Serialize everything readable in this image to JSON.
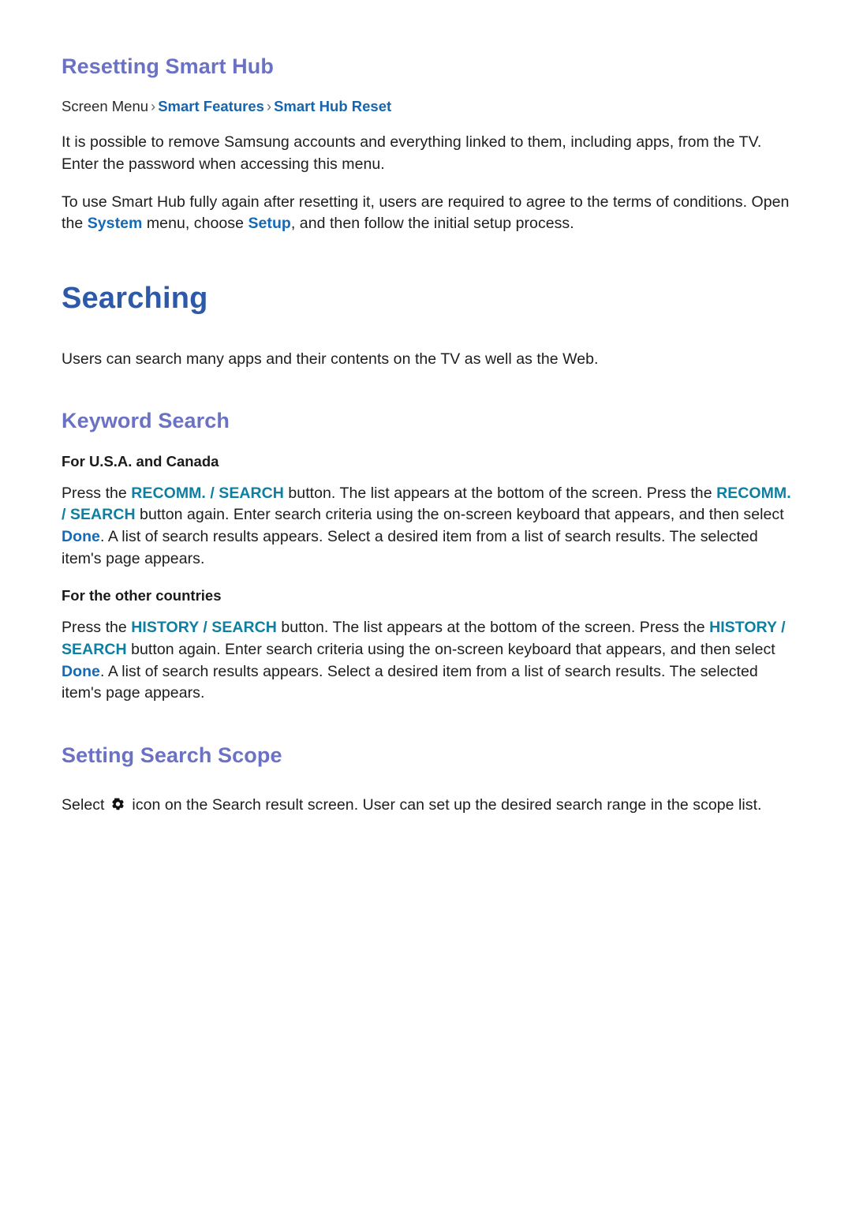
{
  "colors": {
    "section_heading": "#6b72c4",
    "chapter_heading": "#2d5aa8",
    "link_blue": "#1565b0",
    "keyword_blue": "#1569b5",
    "keyword_teal": "#0e7fa0",
    "body_text": "#1d1d1d",
    "page_background": "#ffffff"
  },
  "sections": {
    "resetting": {
      "heading": "Resetting Smart Hub",
      "breadcrumb": {
        "root": "Screen Menu",
        "sep1": "›",
        "item1": "Smart Features",
        "sep2": "›",
        "item2": "Smart Hub Reset"
      },
      "paragraph1": "It is possible to remove Samsung accounts and everything linked to them, including apps, from the TV. Enter the password when accessing this menu.",
      "paragraph2": {
        "part1": "To use Smart Hub fully again after resetting it, users are required to agree to the terms of conditions. Open the ",
        "kw1": "System",
        "part2": " menu, choose ",
        "kw2": "Setup",
        "part3": ", and then follow the initial setup process."
      }
    },
    "searching": {
      "heading": "Searching",
      "intro": "Users can search many apps and their contents on the TV as well as the Web."
    },
    "keyword_search": {
      "heading": "Keyword Search",
      "usa_subhead": "For U.S.A. and Canada",
      "usa_paragraph": {
        "p1": "Press the ",
        "kw1": "RECOMM. / SEARCH",
        "p2": " button. The list appears at the bottom of the screen. Press the ",
        "kw2": "RECOMM. / SEARCH",
        "p3": " button again. Enter search criteria using the on-screen keyboard that appears, and then select ",
        "kw3": "Done",
        "p4": ". A list of search results appears. Select a desired item from a list of search results. The selected item's page appears."
      },
      "other_subhead": "For the other countries",
      "other_paragraph": {
        "p1": "Press the ",
        "kw1": "HISTORY / SEARCH",
        "p2": " button. The list appears at the bottom of the screen. Press the ",
        "kw2": "HISTORY / SEARCH",
        "p3": " button again. Enter search criteria using the on-screen keyboard that appears, and then select ",
        "kw3": "Done",
        "p4": ". A list of search results appears. Select a desired item from a list of search results. The selected item's page appears."
      }
    },
    "search_scope": {
      "heading": "Setting Search Scope",
      "paragraph": {
        "p1": "Select ",
        "icon": "gear-icon",
        "p2": " icon on the Search result screen. User can set up the desired search range in the scope list."
      }
    }
  }
}
